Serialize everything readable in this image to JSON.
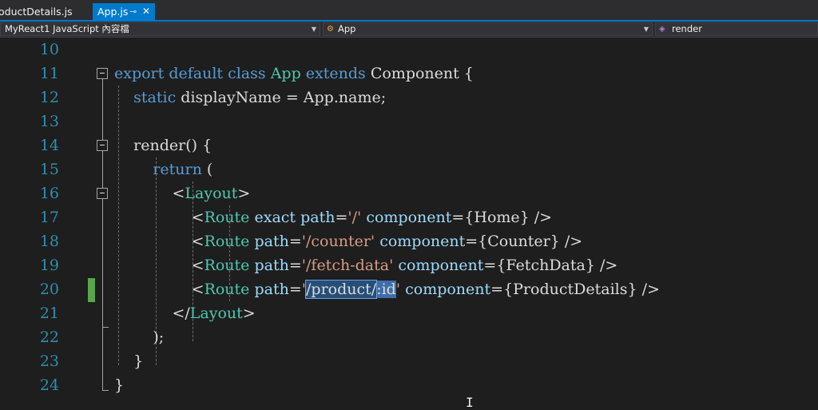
{
  "tabs": [
    {
      "label": "oductDetails.js",
      "active": false
    },
    {
      "label": "App.js",
      "active": true
    }
  ],
  "navbar": {
    "project": "MyReact1 JavaScript 內容檔",
    "class_scope": "App",
    "member_scope": "render"
  },
  "editor": {
    "line_numbers": [
      "10",
      "11",
      "12",
      "13",
      "14",
      "15",
      "16",
      "17",
      "18",
      "19",
      "20",
      "21",
      "22",
      "23",
      "24"
    ],
    "lines": [
      {
        "n": "10",
        "tokens": []
      },
      {
        "n": "11",
        "tokens": [
          [
            "kw",
            "export"
          ],
          [
            "t",
            " "
          ],
          [
            "kw",
            "default"
          ],
          [
            "t",
            " "
          ],
          [
            "kw",
            "class"
          ],
          [
            "t",
            " "
          ],
          [
            "cls",
            "App"
          ],
          [
            "t",
            " "
          ],
          [
            "kw",
            "extends"
          ],
          [
            "t",
            " Component {"
          ]
        ]
      },
      {
        "n": "12",
        "tokens": [
          [
            "t",
            "    "
          ],
          [
            "kw",
            "static"
          ],
          [
            "t",
            " displayName = App.name;"
          ]
        ]
      },
      {
        "n": "13",
        "tokens": []
      },
      {
        "n": "14",
        "tokens": [
          [
            "t",
            "    render() {"
          ]
        ]
      },
      {
        "n": "15",
        "tokens": [
          [
            "t",
            "        "
          ],
          [
            "kw",
            "return"
          ],
          [
            "t",
            " ("
          ]
        ]
      },
      {
        "n": "16",
        "tokens": [
          [
            "t",
            "            <"
          ],
          [
            "tag",
            "Layout"
          ],
          [
            "t",
            ">"
          ]
        ]
      },
      {
        "n": "17",
        "tokens": [
          [
            "t",
            "                <"
          ],
          [
            "tag",
            "Route"
          ],
          [
            "t",
            " "
          ],
          [
            "attr",
            "exact"
          ],
          [
            "t",
            " "
          ],
          [
            "attr",
            "path"
          ],
          [
            "t",
            "="
          ],
          [
            "str",
            "'/'"
          ],
          [
            "t",
            " "
          ],
          [
            "attr",
            "component"
          ],
          [
            "t",
            "={Home} />"
          ]
        ]
      },
      {
        "n": "18",
        "tokens": [
          [
            "t",
            "                <"
          ],
          [
            "tag",
            "Route"
          ],
          [
            "t",
            " "
          ],
          [
            "attr",
            "path"
          ],
          [
            "t",
            "="
          ],
          [
            "str",
            "'/counter'"
          ],
          [
            "t",
            " "
          ],
          [
            "attr",
            "component"
          ],
          [
            "t",
            "={Counter} />"
          ]
        ]
      },
      {
        "n": "19",
        "tokens": [
          [
            "t",
            "                <"
          ],
          [
            "tag",
            "Route"
          ],
          [
            "t",
            " "
          ],
          [
            "attr",
            "path"
          ],
          [
            "t",
            "="
          ],
          [
            "str",
            "'/fetch-data'"
          ],
          [
            "t",
            " "
          ],
          [
            "attr",
            "component"
          ],
          [
            "t",
            "={FetchData} />"
          ]
        ]
      },
      {
        "n": "20",
        "tokens": [
          [
            "t",
            "                <"
          ],
          [
            "tag",
            "Route"
          ],
          [
            "t",
            " "
          ],
          [
            "attr",
            "path"
          ],
          [
            "t",
            "="
          ],
          [
            "str",
            "'"
          ],
          [
            "sel",
            "/product/"
          ],
          [
            "sel2",
            ":id"
          ],
          [
            "str",
            "'"
          ],
          [
            "t",
            " "
          ],
          [
            "attr",
            "component"
          ],
          [
            "t",
            "={ProductDetails} />"
          ]
        ]
      },
      {
        "n": "21",
        "tokens": [
          [
            "t",
            "            </"
          ],
          [
            "tag",
            "Layout"
          ],
          [
            "t",
            ">"
          ]
        ]
      },
      {
        "n": "22",
        "tokens": [
          [
            "t",
            "        );"
          ]
        ]
      },
      {
        "n": "23",
        "tokens": [
          [
            "t",
            "    }"
          ]
        ]
      },
      {
        "n": "24",
        "tokens": [
          [
            "t",
            "}"
          ]
        ]
      }
    ]
  },
  "colors": {
    "background": "#1e1e1e",
    "keyword": "#569cd6",
    "type": "#4ec9b0",
    "string": "#d69d85",
    "attribute": "#9cdcfe",
    "line_number": "#2b91af",
    "accent": "#007acc",
    "change_bar": "#57a64a"
  }
}
